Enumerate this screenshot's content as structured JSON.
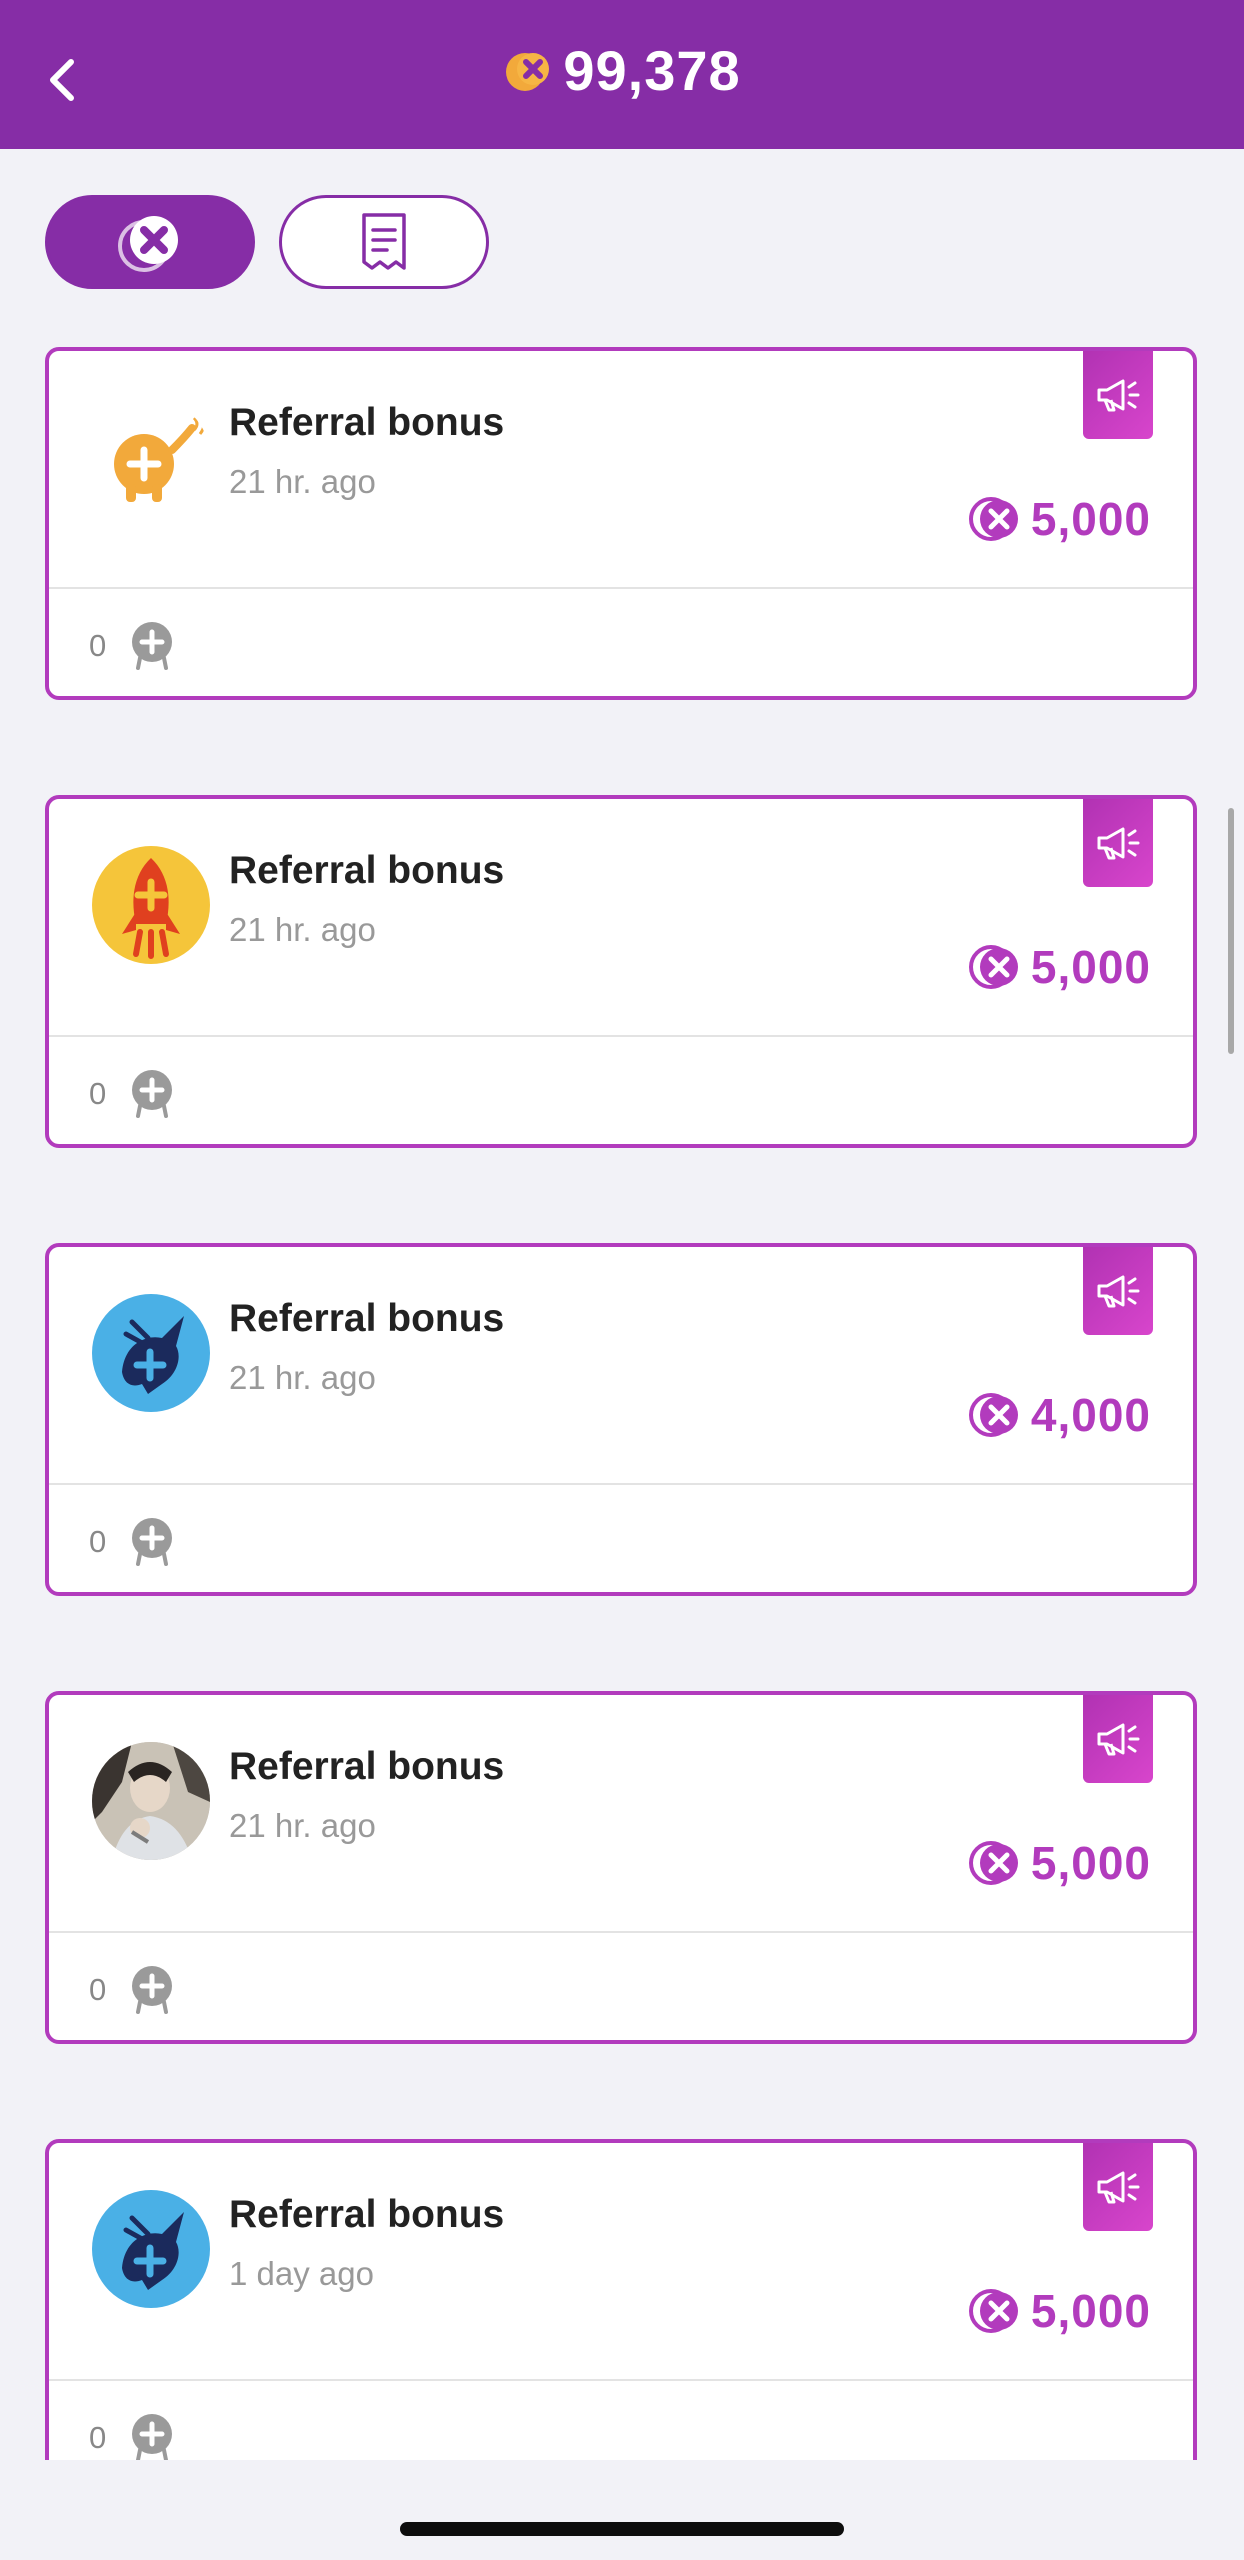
{
  "header": {
    "balance": "99,378",
    "back_icon": "chevron-left-icon",
    "coin_icon": "coin-icon"
  },
  "tabs": [
    {
      "icon": "coin-icon",
      "active": true
    },
    {
      "icon": "receipt-icon",
      "active": false
    }
  ],
  "cards": [
    {
      "title": "Referral bonus",
      "time": "21 hr. ago",
      "amount": "5,000",
      "count": "0",
      "avatar": "mascot-avatar"
    },
    {
      "title": "Referral bonus",
      "time": "21 hr. ago",
      "amount": "5,000",
      "count": "0",
      "avatar": "rocket-avatar"
    },
    {
      "title": "Referral bonus",
      "time": "21 hr. ago",
      "amount": "4,000",
      "count": "0",
      "avatar": "bird-avatar"
    },
    {
      "title": "Referral bonus",
      "time": "21 hr. ago",
      "amount": "5,000",
      "count": "0",
      "avatar": "photo-avatar"
    },
    {
      "title": "Referral bonus",
      "time": "1 day ago",
      "amount": "5,000",
      "count": "0",
      "avatar": "bird-avatar"
    }
  ],
  "colors": {
    "brand": "#862da6",
    "accent": "#b23bbd",
    "ribbon": "#d845cc",
    "coin": "#f2a93b"
  }
}
